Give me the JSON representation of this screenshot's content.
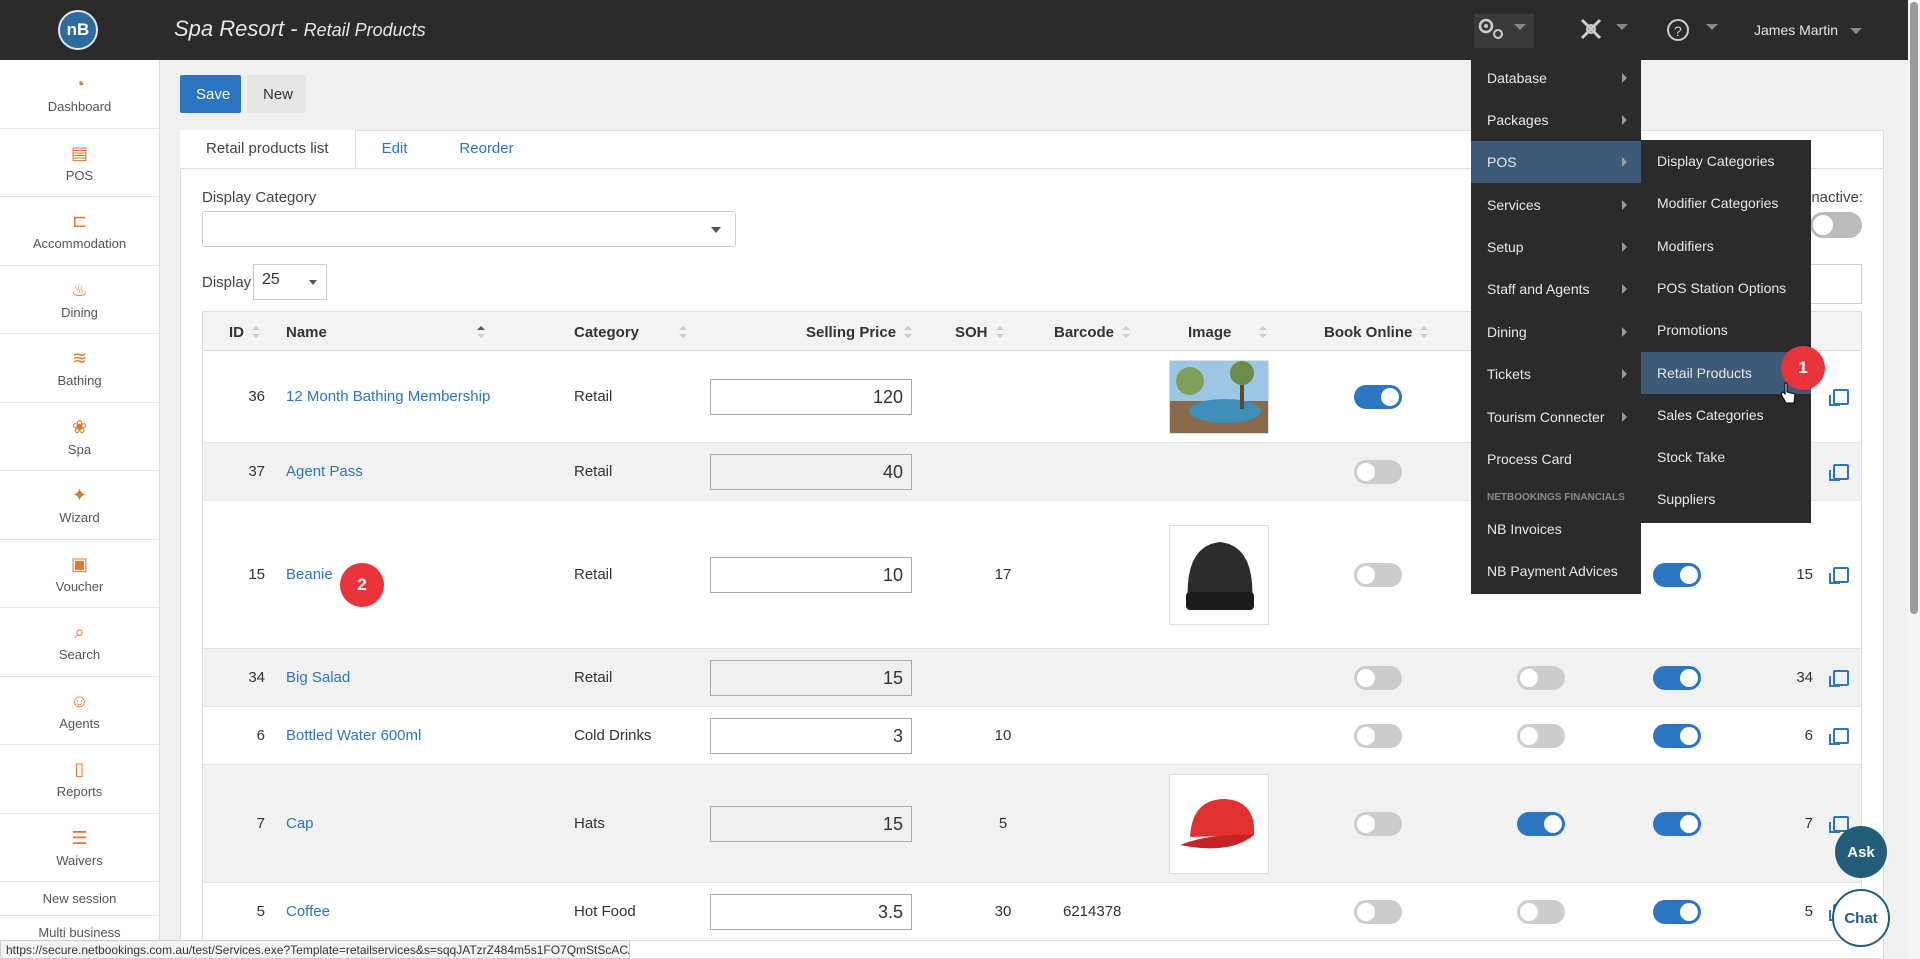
{
  "header": {
    "logo_text": "nB",
    "title": "Spa Resort",
    "separator": " - ",
    "subtitle": "Retail Products",
    "user_name": "James Martin",
    "icons": [
      "settings-gears-icon",
      "tools-icon",
      "help-icon"
    ]
  },
  "sidebar": {
    "items": [
      {
        "label": "Dashboard",
        "icon": "dashboard-icon"
      },
      {
        "label": "POS",
        "icon": "register-icon"
      },
      {
        "label": "Accommodation",
        "icon": "bed-icon"
      },
      {
        "label": "Dining",
        "icon": "dining-icon"
      },
      {
        "label": "Bathing",
        "icon": "waves-icon"
      },
      {
        "label": "Spa",
        "icon": "lotus-icon"
      },
      {
        "label": "Wizard",
        "icon": "wand-icon"
      },
      {
        "label": "Voucher",
        "icon": "gift-icon"
      },
      {
        "label": "Search",
        "icon": "search-icon"
      },
      {
        "label": "Agents",
        "icon": "agents-icon"
      },
      {
        "label": "Reports",
        "icon": "report-icon"
      },
      {
        "label": "Waivers",
        "icon": "checklist-icon"
      }
    ],
    "new_session": "New session",
    "multi_business": "Multi business"
  },
  "toolbar": {
    "save_label": "Save",
    "new_label": "New"
  },
  "tabs": [
    {
      "label": "Retail products list",
      "active": true
    },
    {
      "label": "Edit",
      "active": false
    },
    {
      "label": "Reorder",
      "active": false
    }
  ],
  "filters": {
    "display_category_label": "Display Category",
    "display_category_value": "",
    "display_label": "Display",
    "display_value": "25",
    "inactive_label": "inactive:"
  },
  "table": {
    "columns": [
      "ID",
      "Name",
      "Category",
      "Selling Price",
      "SOH",
      "Barcode",
      "Image",
      "Book Online"
    ],
    "rows": [
      {
        "id": "36",
        "name": "12 Month Bathing Membership",
        "category": "Retail",
        "price": "120",
        "soh": "",
        "barcode": "",
        "image": "pool",
        "book_online": true,
        "t2": null,
        "t3": null,
        "dup": ""
      },
      {
        "id": "37",
        "name": "Agent Pass",
        "category": "Retail",
        "price": "40",
        "soh": "",
        "barcode": "",
        "image": "",
        "book_online": false,
        "t2": null,
        "t3": null,
        "dup": ""
      },
      {
        "id": "15",
        "name": "Beanie",
        "category": "Retail",
        "price": "10",
        "soh": "17",
        "barcode": "",
        "image": "beanie",
        "book_online": false,
        "t2": null,
        "t3": true,
        "dup": "15"
      },
      {
        "id": "34",
        "name": "Big Salad",
        "category": "Retail",
        "price": "15",
        "soh": "",
        "barcode": "",
        "image": "",
        "book_online": false,
        "t2": false,
        "t3": true,
        "dup": "34"
      },
      {
        "id": "6",
        "name": "Bottled Water 600ml",
        "category": "Cold Drinks",
        "price": "3",
        "soh": "10",
        "barcode": "",
        "image": "",
        "book_online": false,
        "t2": false,
        "t3": true,
        "dup": "6"
      },
      {
        "id": "7",
        "name": "Cap",
        "category": "Hats",
        "price": "15",
        "soh": "5",
        "barcode": "",
        "image": "cap",
        "book_online": false,
        "t2": true,
        "t3": true,
        "dup": "7"
      },
      {
        "id": "5",
        "name": "Coffee",
        "category": "Hot Food",
        "price": "3.5",
        "soh": "30",
        "barcode": "6214378",
        "image": "",
        "book_online": false,
        "t2": false,
        "t3": true,
        "dup": "5"
      }
    ]
  },
  "menu_main": {
    "items": [
      {
        "label": "Database",
        "submenu": true
      },
      {
        "label": "Packages",
        "submenu": true
      },
      {
        "label": "POS",
        "submenu": true,
        "active": true
      },
      {
        "label": "Services",
        "submenu": true
      },
      {
        "label": "Setup",
        "submenu": true
      },
      {
        "label": "Staff and Agents",
        "submenu": true
      },
      {
        "label": "Dining",
        "submenu": true
      },
      {
        "label": "Tickets",
        "submenu": true
      },
      {
        "label": "Tourism Connecter",
        "submenu": true
      },
      {
        "label": "Process Card",
        "submenu": false
      }
    ],
    "section_header": "NETBOOKINGS FINANCIALS",
    "financial_items": [
      "NB Invoices",
      "NB Payment Advices"
    ]
  },
  "menu_pos": {
    "items": [
      "Display Categories",
      "Modifier Categories",
      "Modifiers",
      "POS Station Options",
      "Promotions",
      "Retail Products",
      "Sales Categories",
      "Stock Take",
      "Suppliers"
    ],
    "hover_index": 5
  },
  "annotations": {
    "badge1": "1",
    "badge2": "2"
  },
  "widgets": {
    "ask": "Ask",
    "chat": "Chat"
  },
  "status_url": "https://secure.netbookings.com.au/test/Services.exe?Template=retailservices&s=sqqJATzrZ484m5s1FO7QmStScACA...",
  "colors": {
    "accent": "#2c75c0",
    "topbar": "#2b2b2b",
    "nav_icon": "#e8742a",
    "badge": "#e8343a"
  }
}
